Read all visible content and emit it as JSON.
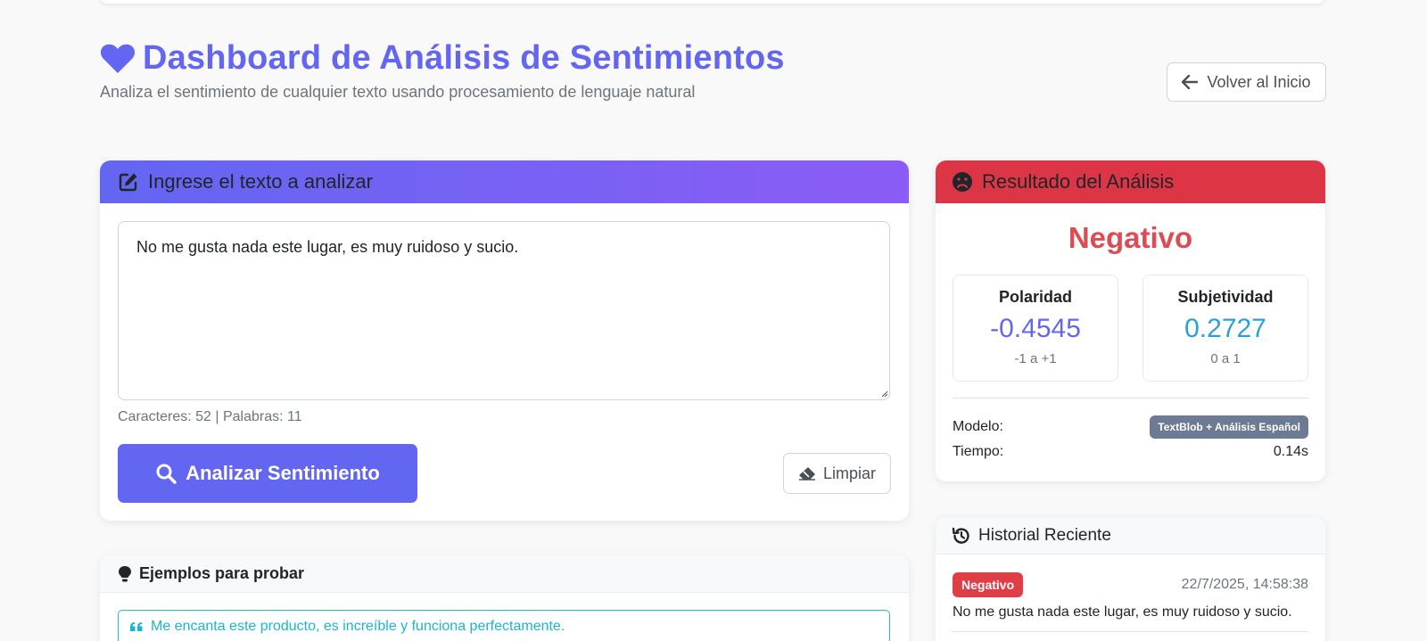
{
  "header": {
    "title": "Dashboard de Análisis de Sentimientos",
    "subtitle": "Analiza el sentimiento de cualquier texto usando procesamiento de lenguaje natural",
    "back_label": "Volver al Inicio"
  },
  "input": {
    "heading": "Ingrese el texto a analizar",
    "text": "No me gusta nada este lugar, es muy ruidoso y sucio.",
    "counter": "Caracteres: 52 | Palabras: 11",
    "analyze_label": "Analizar Sentimiento",
    "clear_label": "Limpiar"
  },
  "result": {
    "heading": "Resultado del Análisis",
    "sentiment": "Negativo",
    "polarity": {
      "title": "Polaridad",
      "value": "-0.4545",
      "range": "-1 a +1"
    },
    "subjectivity": {
      "title": "Subjetividad",
      "value": "0.2727",
      "range": "0 a 1"
    },
    "model_label": "Modelo:",
    "model_value": "TextBlob + Análisis Español",
    "time_label": "Tiempo:",
    "time_value": "0.14s"
  },
  "examples": {
    "heading": "Ejemplos para probar",
    "items": [
      "Me encanta este producto, es increíble y funciona perfectamente."
    ]
  },
  "history": {
    "heading": "Historial Reciente",
    "items": [
      {
        "badge": "Negativo",
        "time": "22/7/2025, 14:58:38",
        "text": "No me gusta nada este lugar, es muy ruidoso y sucio."
      }
    ]
  },
  "colors": {
    "accent": "#6366f1",
    "negative": "#dc3545",
    "polarity_value": "#6366f1",
    "subjectivity_value": "#2c9fd9",
    "example_text": "#1ab5cf"
  }
}
